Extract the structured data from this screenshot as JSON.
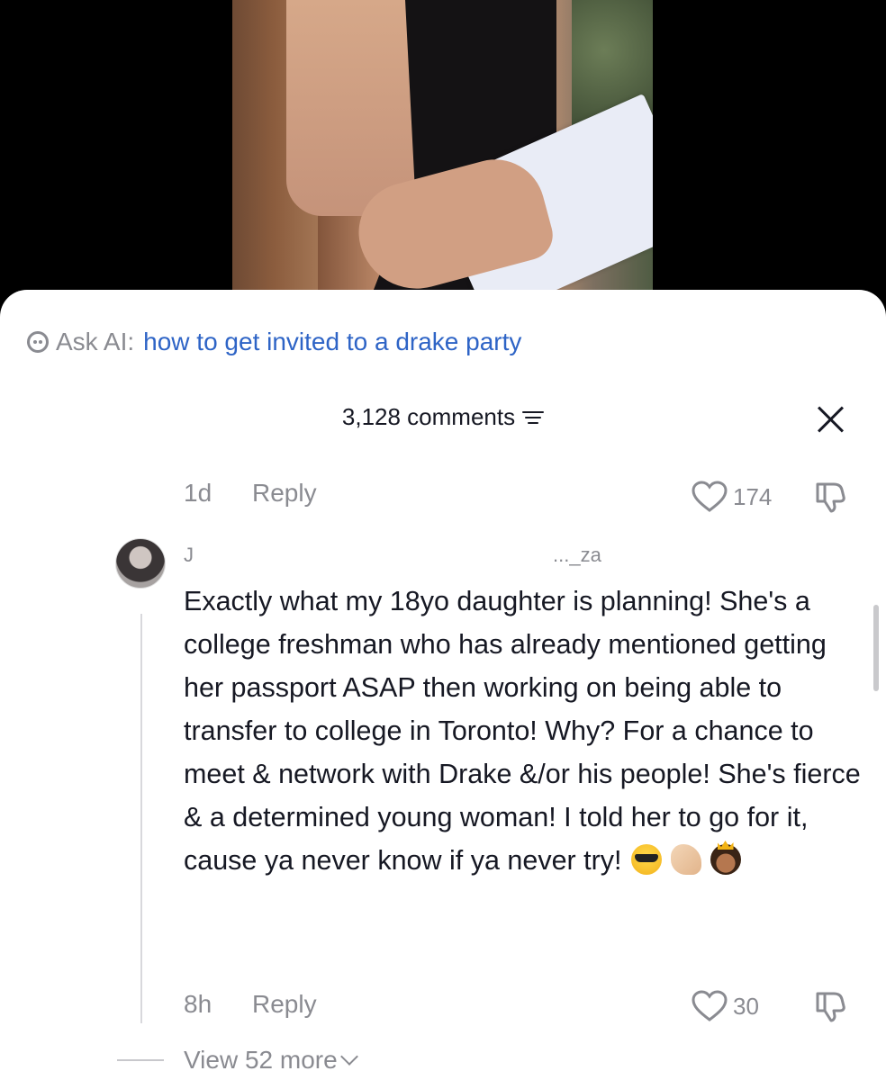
{
  "ask_ai": {
    "prefix": "Ask AI:",
    "query": "how to get invited to a drake party"
  },
  "header": {
    "count_label": "3,128 comments"
  },
  "first_comment_meta": {
    "time": "1d",
    "reply_label": "Reply",
    "likes": "174"
  },
  "comment": {
    "username_start": "J",
    "username_end": "..._za",
    "text": "Exactly what my 18yo daughter is planning! She's a college freshman who has already mentioned getting her passport ASAP then working on being able to transfer to college in Toronto! Why? For a chance to meet & network with Drake &/or his people! She's fierce & a determined young woman! I told her to go for it, cause ya never know if ya never try!",
    "emojis": [
      "smiling-face-with-sunglasses",
      "flexed-biceps",
      "princess"
    ],
    "time": "8h",
    "reply_label": "Reply",
    "likes": "30"
  },
  "view_more": {
    "label": "View 52 more"
  },
  "colors": {
    "link": "#2e64c6",
    "muted": "#8a8b91",
    "text": "#161823"
  }
}
